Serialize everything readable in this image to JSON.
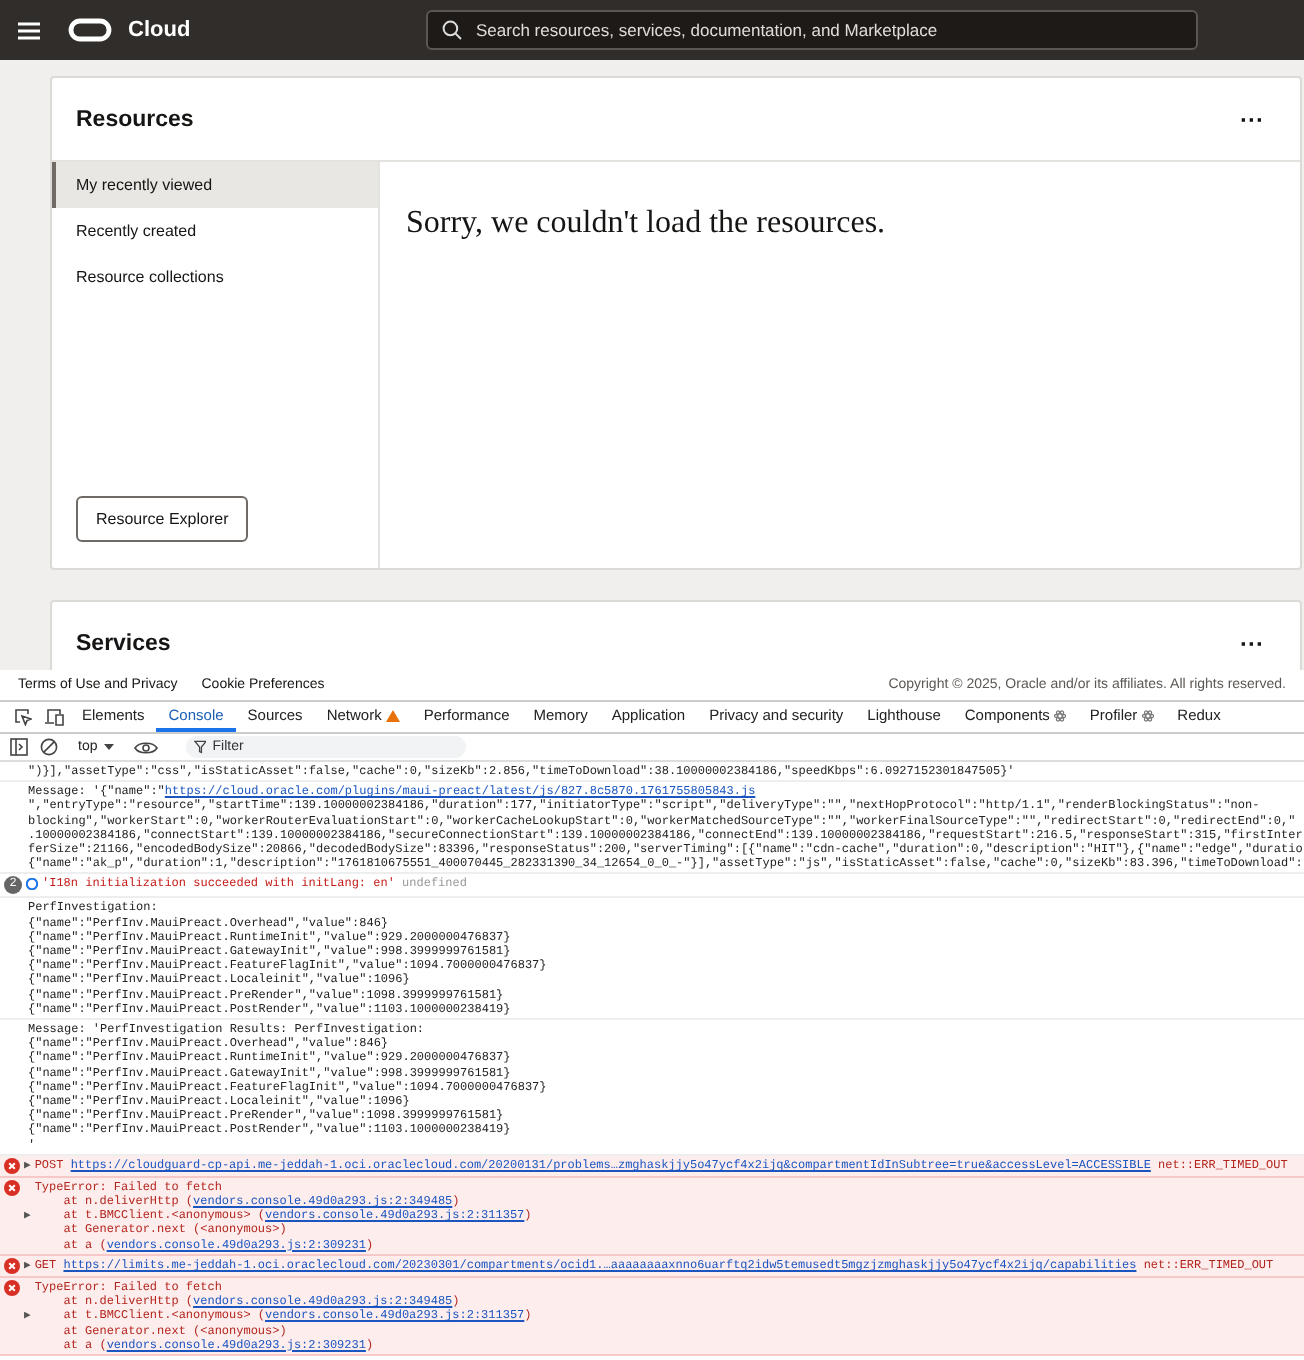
{
  "topbar": {
    "brand": "Cloud",
    "search": {
      "placeholder": "Search resources, services, documentation, and Marketplace"
    }
  },
  "resources": {
    "title": "Resources",
    "menu": "···",
    "tabs": [
      {
        "label": "My recently viewed",
        "selected": true
      },
      {
        "label": "Recently created",
        "selected": false
      },
      {
        "label": "Resource collections",
        "selected": false
      }
    ],
    "message": "Sorry, we couldn't load the resources.",
    "button": "Resource Explorer"
  },
  "services": {
    "title": "Services",
    "menu": "···"
  },
  "footer": {
    "links": [
      "Terms of Use and Privacy",
      "Cookie Preferences"
    ],
    "copyright": "Copyright © 2025, Oracle and/or its affiliates. All rights reserved."
  },
  "devtools": {
    "tabs": [
      {
        "label": "Elements",
        "selected": false,
        "kind": "plain"
      },
      {
        "label": "Console",
        "selected": true,
        "kind": "plain"
      },
      {
        "label": "Sources",
        "selected": false,
        "kind": "plain"
      },
      {
        "label": "Network",
        "selected": false,
        "kind": "warning"
      },
      {
        "label": "Performance",
        "selected": false,
        "kind": "plain"
      },
      {
        "label": "Memory",
        "selected": false,
        "kind": "plain"
      },
      {
        "label": "Application",
        "selected": false,
        "kind": "plain"
      },
      {
        "label": "Privacy and security",
        "selected": false,
        "kind": "plain"
      },
      {
        "label": "Lighthouse",
        "selected": false,
        "kind": "plain"
      },
      {
        "label": "Components",
        "selected": false,
        "kind": "react"
      },
      {
        "label": "Profiler",
        "selected": false,
        "kind": "react"
      },
      {
        "label": "Redux",
        "selected": false,
        "kind": "plain"
      }
    ],
    "context": "top",
    "filter": {
      "placeholder": "Filter"
    },
    "console": [
      {
        "kind": "log",
        "lines": [
          [
            {
              "kind": "text",
              "text": "\")}],\"assetType\":\"css\",\"isStaticAsset\":false,\"cache\":0,\"sizeKb\":2.856,\"timeToDownload\":38.10000002384186,\"speedKbps\":6.0927152301847505}'"
            }
          ]
        ]
      },
      {
        "kind": "log",
        "lines": [
          [
            {
              "kind": "text",
              "text": "Message: '{\"name\":\""
            },
            {
              "kind": "link",
              "text": "https://cloud.oracle.com/plugins/maui-preact/latest/js/827.8c5870.1761755805843.js"
            }
          ],
          [
            {
              "kind": "text",
              "text": "\",\"entryType\":\"resource\",\"startTime\":139.10000002384186,\"duration\":177,\"initiatorType\":\"script\",\"deliveryType\":\"\",\"nextHopProtocol\":\"http/1.1\",\"renderBlockingStatus\":\"non-"
            }
          ],
          [
            {
              "kind": "text",
              "text": "blocking\",\"workerStart\":0,\"workerRouterEvaluationStart\":0,\"workerCacheLookupStart\":0,\"workerMatchedSourceType\":\"\",\"workerFinalSourceType\":\"\",\"redirectStart\":0,\"redirectEnd\":0,\""
            }
          ],
          [
            {
              "kind": "text",
              "text": ".10000002384186,\"connectStart\":139.10000002384186,\"secureConnectionStart\":139.10000002384186,\"connectEnd\":139.10000002384186,\"requestStart\":216.5,\"responseStart\":315,\"firstInter"
            }
          ],
          [
            {
              "kind": "text",
              "text": "ferSize\":21166,\"encodedBodySize\":20866,\"decodedBodySize\":83396,\"responseStatus\":200,\"serverTiming\":[{\"name\":\"cdn-cache\",\"duration\":0,\"description\":\"HIT\"},{\"name\":\"edge\",\"duratio"
            }
          ],
          [
            {
              "kind": "text",
              "text": "{\"name\":\"ak_p\",\"duration\":1,\"description\":\"1761810675551_400070445_282331390_34_12654_0_0_-\"}],\"assetType\":\"js\",\"isStaticAsset\":false,\"cache\":0,\"sizeKb\":83.396,\"timeToDownload\":"
            }
          ]
        ]
      },
      {
        "kind": "info",
        "count": "2",
        "lines": [
          [
            {
              "kind": "string",
              "text": "'I18n initialization succeeded with initLang: en'"
            },
            {
              "kind": "muted",
              "text": " undefined"
            }
          ]
        ]
      },
      {
        "kind": "log",
        "lines": [
          [
            {
              "kind": "text",
              "text": "PerfInvestigation:"
            }
          ],
          [
            {
              "kind": "text",
              "text": "{\"name\":\"PerfInv.MauiPreact.Overhead\",\"value\":846}"
            }
          ],
          [
            {
              "kind": "text",
              "text": "{\"name\":\"PerfInv.MauiPreact.RuntimeInit\",\"value\":929.2000000476837}"
            }
          ],
          [
            {
              "kind": "text",
              "text": "{\"name\":\"PerfInv.MauiPreact.GatewayInit\",\"value\":998.3999999761581}"
            }
          ],
          [
            {
              "kind": "text",
              "text": "{\"name\":\"PerfInv.MauiPreact.FeatureFlagInit\",\"value\":1094.7000000476837}"
            }
          ],
          [
            {
              "kind": "text",
              "text": "{\"name\":\"PerfInv.MauiPreact.Localeinit\",\"value\":1096}"
            }
          ],
          [
            {
              "kind": "text",
              "text": "{\"name\":\"PerfInv.MauiPreact.PreRender\",\"value\":1098.3999999761581}"
            }
          ],
          [
            {
              "kind": "text",
              "text": "{\"name\":\"PerfInv.MauiPreact.PostRender\",\"value\":1103.1000000238419}"
            }
          ]
        ]
      },
      {
        "kind": "log",
        "lines": [
          [
            {
              "kind": "text",
              "text": "Message: 'PerfInvestigation Results: PerfInvestigation:"
            }
          ],
          [
            {
              "kind": "text",
              "text": "{\"name\":\"PerfInv.MauiPreact.Overhead\",\"value\":846}"
            }
          ],
          [
            {
              "kind": "text",
              "text": "{\"name\":\"PerfInv.MauiPreact.RuntimeInit\",\"value\":929.2000000476837}"
            }
          ],
          [
            {
              "kind": "text",
              "text": "{\"name\":\"PerfInv.MauiPreact.GatewayInit\",\"value\":998.3999999761581}"
            }
          ],
          [
            {
              "kind": "text",
              "text": "{\"name\":\"PerfInv.MauiPreact.FeatureFlagInit\",\"value\":1094.7000000476837}"
            }
          ],
          [
            {
              "kind": "text",
              "text": "{\"name\":\"PerfInv.MauiPreact.Localeinit\",\"value\":1096}"
            }
          ],
          [
            {
              "kind": "text",
              "text": "{\"name\":\"PerfInv.MauiPreact.PreRender\",\"value\":1098.3999999761581}"
            }
          ],
          [
            {
              "kind": "text",
              "text": "{\"name\":\"PerfInv.MauiPreact.PostRender\",\"value\":1103.1000000238419}"
            }
          ],
          [
            {
              "kind": "text",
              "text": "'"
            }
          ]
        ]
      },
      {
        "kind": "error",
        "toggle": "▶",
        "lines": [
          [
            {
              "kind": "text",
              "text": "POST "
            },
            {
              "kind": "link",
              "text": "https://cloudguard-cp-api.me-jeddah-1.oci.oraclecloud.com/20200131/problems…zmghaskjjy5o47ycf4x2ijq&compartmentIdInSubtree=true&accessLevel=ACCESSIBLE"
            },
            {
              "kind": "text",
              "text": " net::ERR_TIMED_OUT"
            }
          ]
        ]
      },
      {
        "kind": "error",
        "toggle": "▶",
        "lines": [
          [
            {
              "kind": "text",
              "text": "TypeError: Failed to fetch"
            }
          ],
          [
            {
              "kind": "text",
              "text": "    at n.deliverHttp ("
            },
            {
              "kind": "link",
              "text": "vendors.console.49d0a293.js:2:349485"
            },
            {
              "kind": "text",
              "text": ")"
            }
          ],
          [
            {
              "kind": "text",
              "text": "    at t.BMCClient.<anonymous> ("
            },
            {
              "kind": "link",
              "text": "vendors.console.49d0a293.js:2:311357"
            },
            {
              "kind": "text",
              "text": ")"
            }
          ],
          [
            {
              "kind": "text",
              "text": "    at Generator.next (<anonymous>)"
            }
          ],
          [
            {
              "kind": "text",
              "text": "    at a ("
            },
            {
              "kind": "link",
              "text": "vendors.console.49d0a293.js:2:309231"
            },
            {
              "kind": "text",
              "text": ")"
            }
          ]
        ]
      },
      {
        "kind": "error",
        "toggle": "▶",
        "lines": [
          [
            {
              "kind": "text",
              "text": "GET "
            },
            {
              "kind": "link",
              "text": "https://limits.me-jeddah-1.oci.oraclecloud.com/20230301/compartments/ocid1.…aaaaaaaaxnno6uarftq2idw5temusedt5mgzjzmghaskjjy5o47ycf4x2ijq/capabilities"
            },
            {
              "kind": "text",
              "text": " net::ERR_TIMED_OUT"
            }
          ]
        ]
      },
      {
        "kind": "error",
        "toggle": "▶",
        "lines": [
          [
            {
              "kind": "text",
              "text": "TypeError: Failed to fetch"
            }
          ],
          [
            {
              "kind": "text",
              "text": "    at n.deliverHttp ("
            },
            {
              "kind": "link",
              "text": "vendors.console.49d0a293.js:2:349485"
            },
            {
              "kind": "text",
              "text": ")"
            }
          ],
          [
            {
              "kind": "text",
              "text": "    at t.BMCClient.<anonymous> ("
            },
            {
              "kind": "link",
              "text": "vendors.console.49d0a293.js:2:311357"
            },
            {
              "kind": "text",
              "text": ")"
            }
          ],
          [
            {
              "kind": "text",
              "text": "    at Generator.next (<anonymous>)"
            }
          ],
          [
            {
              "kind": "text",
              "text": "    at a ("
            },
            {
              "kind": "link",
              "text": "vendors.console.49d0a293.js:2:309231"
            },
            {
              "kind": "text",
              "text": ")"
            }
          ]
        ]
      }
    ]
  }
}
